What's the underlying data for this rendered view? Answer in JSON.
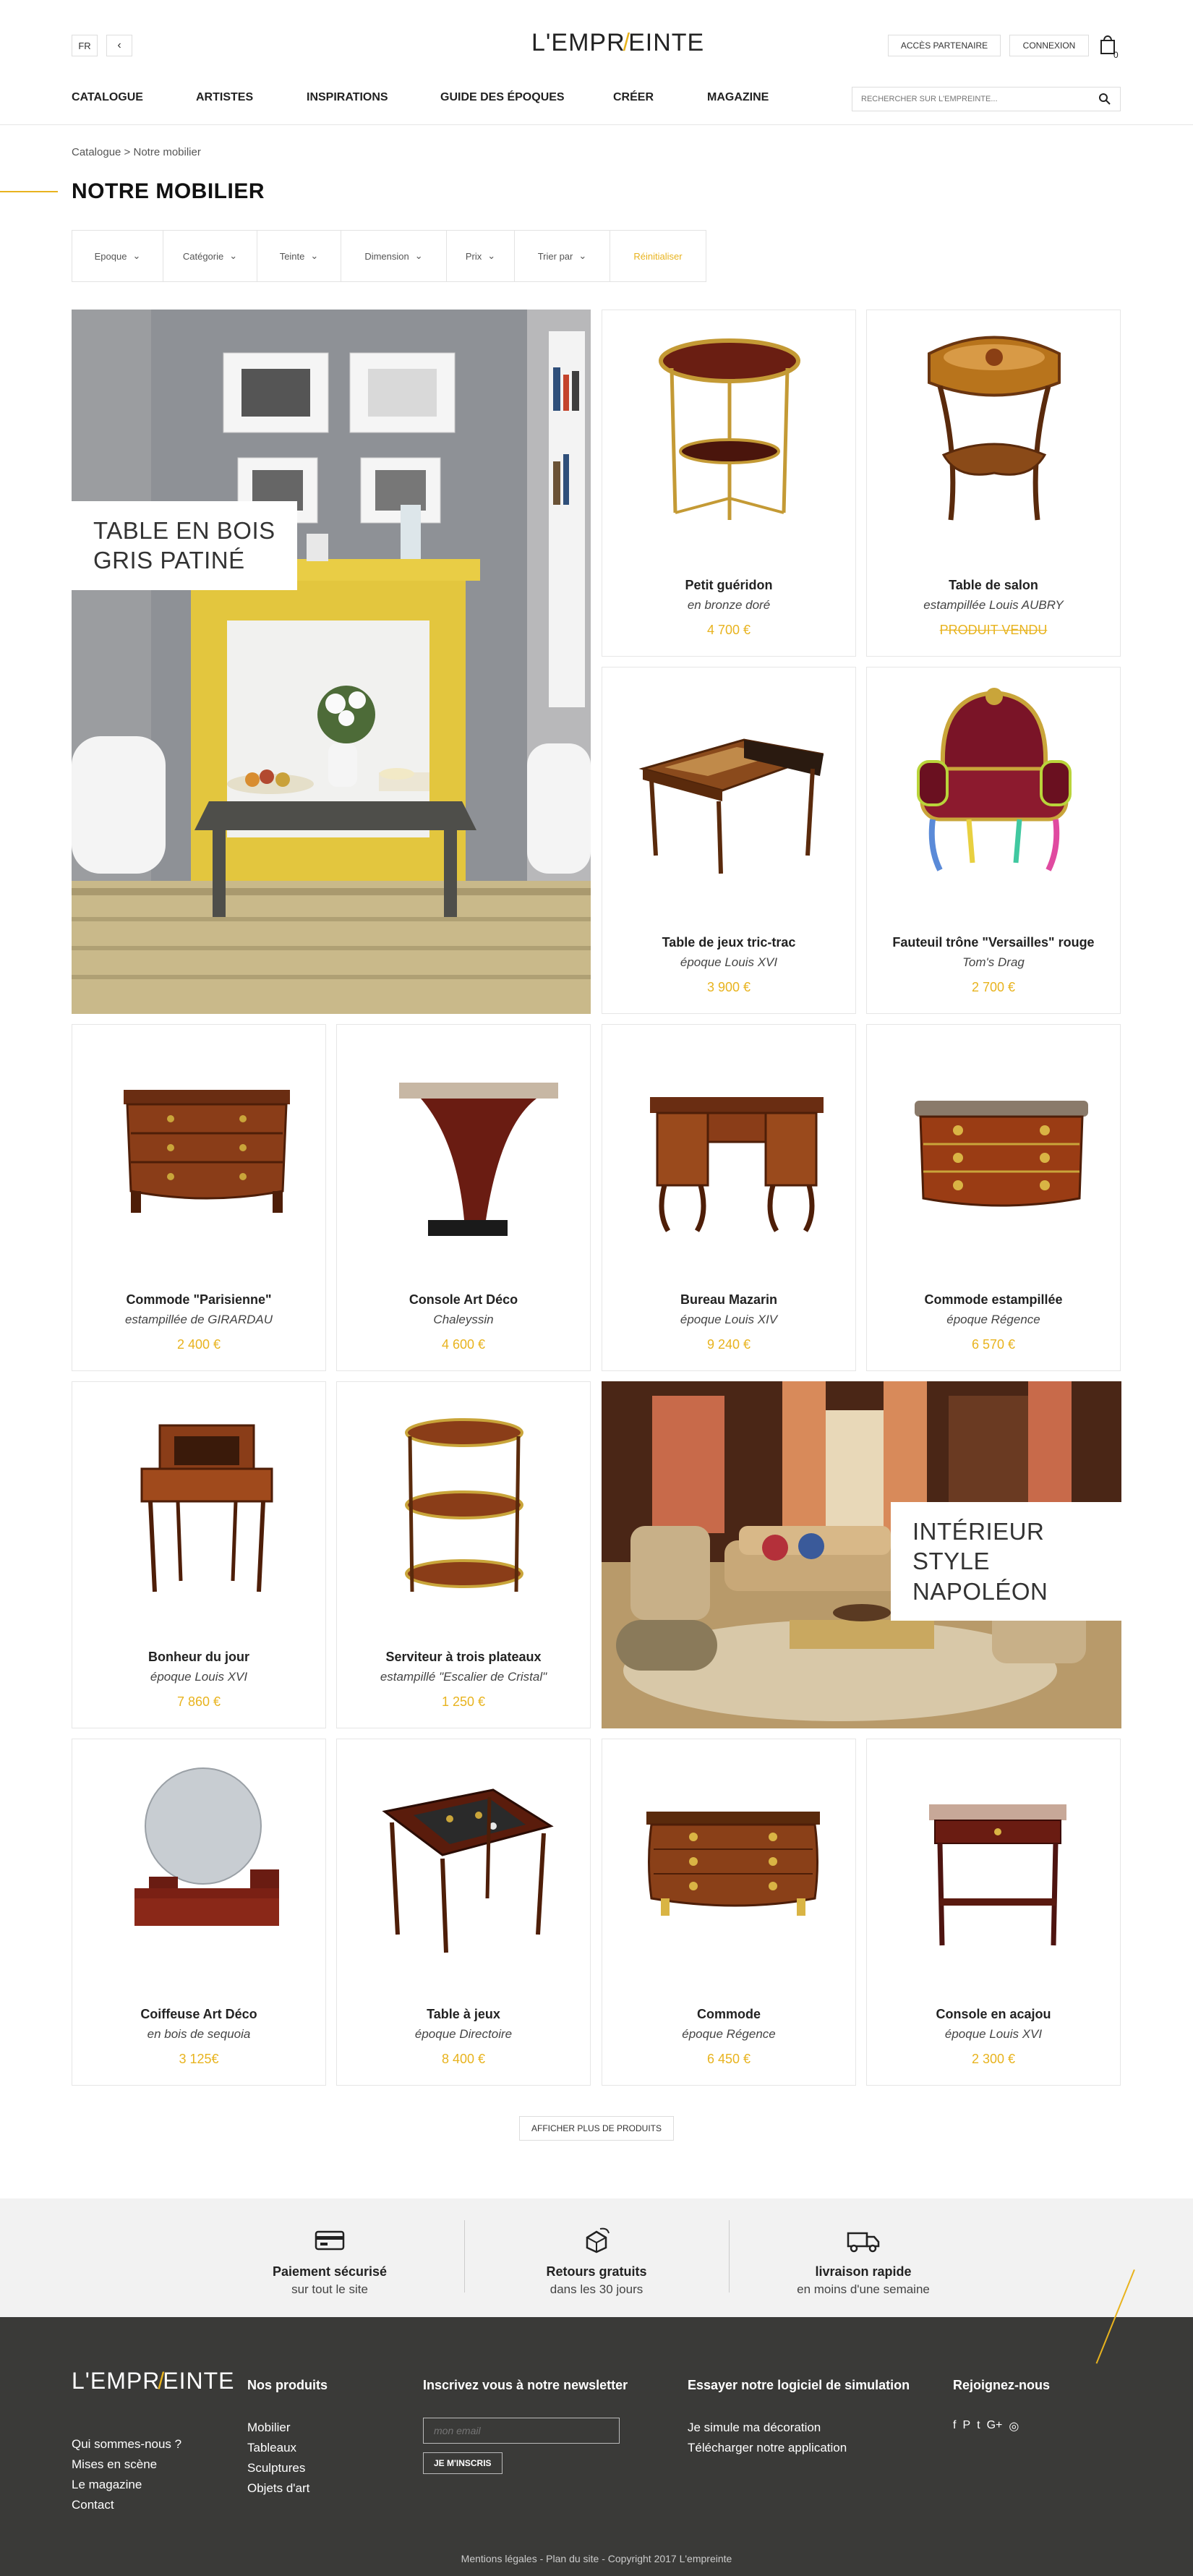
{
  "header": {
    "lang": "FR",
    "back": "‹",
    "logo_left": "L'EMPR",
    "logo_right": "EINTE",
    "partner": "ACCÈS PARTENAIRE",
    "login": "CONNEXION",
    "cart_count": "0"
  },
  "nav": [
    "CATALOGUE",
    "ARTISTES",
    "INSPIRATIONS",
    "GUIDE DES ÉPOQUES",
    "CRÉER",
    "MAGAZINE"
  ],
  "search": {
    "placeholder": "RECHERCHER SUR L'EMPREINTE..."
  },
  "breadcrumb": "Catalogue > Notre mobilier",
  "page_title": "NOTRE MOBILIER",
  "filters": [
    "Epoque",
    "Catégorie",
    "Teinte",
    "Dimension",
    "Prix",
    "Trier par",
    "Réinitialiser"
  ],
  "feature1": {
    "label_line1": "TABLE EN BOIS",
    "label_line2": "GRIS PATINÉ"
  },
  "feature2": {
    "label_line1": "INTÉRIEUR STYLE",
    "label_line2": "NAPOLÉON"
  },
  "products": [
    {
      "name": "Petit guéridon",
      "sub": "en bronze doré",
      "price": "4 700 €",
      "icon": "gueridon-icon"
    },
    {
      "name": "Table de salon",
      "sub": "estampillée Louis AUBRY",
      "price": "PRODUIT VENDU",
      "icon": "salon-table-icon"
    },
    {
      "name": "Table de jeux tric-trac",
      "sub": "époque Louis XVI",
      "price": "3 900 €",
      "icon": "game-table-icon"
    },
    {
      "name": "Fauteuil trône \"Versailles\" rouge",
      "sub": "Tom's Drag",
      "price": "2 700 €",
      "icon": "throne-armchair-icon"
    },
    {
      "name": "Commode \"Parisienne\"",
      "sub": "estampillée de GIRARDAU",
      "price": "2 400 €",
      "icon": "commode-icon"
    },
    {
      "name": "Console Art Déco",
      "sub": "Chaleyssin",
      "price": "4 600 €",
      "icon": "console-icon"
    },
    {
      "name": "Bureau Mazarin",
      "sub": "époque Louis XIV",
      "price": "9 240 €",
      "icon": "desk-icon"
    },
    {
      "name": "Commode estampillée",
      "sub": "époque Régence",
      "price": "6 570 €",
      "icon": "commode-icon"
    },
    {
      "name": "Bonheur du jour",
      "sub": "époque Louis XVI",
      "price": "7 860 €",
      "icon": "writing-desk-icon"
    },
    {
      "name": "Serviteur à trois plateaux",
      "sub": "estampillé \"Escalier de Cristal\"",
      "price": "1 250 €",
      "icon": "etagere-icon"
    },
    {
      "name": "Coiffeuse Art Déco",
      "sub": "en bois de sequoia",
      "price": "3 125€",
      "icon": "vanity-icon"
    },
    {
      "name": "Table à jeux",
      "sub": "époque Directoire",
      "price": "8 400 €",
      "icon": "game-table-icon"
    },
    {
      "name": "Commode",
      "sub": "époque Régence",
      "price": "6 450 €",
      "icon": "commode-icon"
    },
    {
      "name": "Console en acajou",
      "sub": "époque Louis XVI",
      "price": "2 300 €",
      "icon": "console-icon"
    }
  ],
  "more_button": "AFFICHER PLUS DE PRODUITS",
  "benefits": [
    {
      "title": "Paiement sécurisé",
      "sub": "sur tout le site",
      "icon": "credit-card-icon"
    },
    {
      "title": "Retours gratuits",
      "sub": "dans les 30 jours",
      "icon": "return-box-icon"
    },
    {
      "title": "livraison rapide",
      "sub": "en moins d'une semaine",
      "icon": "delivery-truck-icon"
    }
  ],
  "footer": {
    "about_links": [
      "Qui sommes-nous ?",
      "Mises en scène",
      "Le magazine",
      "Contact"
    ],
    "products_title": "Nos produits",
    "products_links": [
      "Mobilier",
      "Tableaux",
      "Sculptures",
      "Objets d'art"
    ],
    "newsletter_title": "Inscrivez vous à notre newsletter",
    "email_placeholder": "mon email",
    "subscribe": "JE M'INSCRIS",
    "sim_title": "Essayer notre logiciel de simulation",
    "sim_links": [
      "Je simule ma décoration",
      "Télécharger notre application"
    ],
    "social_title": "Rejoignez-nous",
    "social_icons": [
      "f",
      "P",
      "t",
      "G+",
      "◎"
    ],
    "copyright": "Mentions légales - Plan du site - Copyright 2017 L'empreinte"
  },
  "colors": {
    "accent": "#e8b31e",
    "footer_bg": "#3a3a38",
    "band_bg": "#f2f2f2"
  }
}
